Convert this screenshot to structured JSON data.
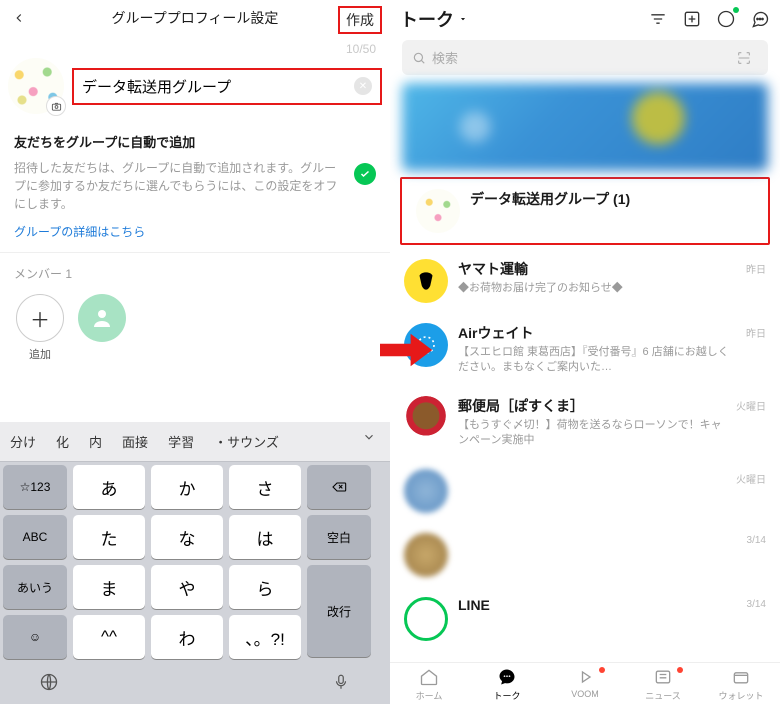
{
  "left": {
    "header": {
      "title": "グループプロフィール設定",
      "create": "作成"
    },
    "counter": "10/50",
    "group_name": "データ転送用グループ",
    "auto_add": {
      "heading": "友だちをグループに自動で追加",
      "desc": "招待した友だちは、グループに自動で追加されます。グループに参加するか友だちに選んでもらうには、この設定をオフにします。",
      "link": "グループの詳細はこちら"
    },
    "members_label": "メンバー 1",
    "members": {
      "add": "追加",
      "user1": "　"
    },
    "keyboard": {
      "pred": [
        "分け",
        "化",
        "内",
        "面接",
        "学習",
        "・サウンズ"
      ],
      "row1": {
        "fn_l": "☆123",
        "k1": "あ",
        "k2": "か",
        "k3": "さ",
        "fn_r": "⌫"
      },
      "row2": {
        "fn_l": "ABC",
        "k1": "た",
        "k2": "な",
        "k3": "は",
        "fn_r": "空白"
      },
      "row3": {
        "fn_l": "あいう",
        "k1": "ま",
        "k2": "や",
        "k3": "ら",
        "fn_r": "改行"
      },
      "row4": {
        "fn_l": "☺",
        "k1": "^^",
        "k2": "わ",
        "k3": "、。?!"
      }
    }
  },
  "right": {
    "header": {
      "title": "トーク"
    },
    "search": "検索",
    "chats": [
      {
        "name": "データ転送用グループ (1)",
        "sub": "",
        "time": ""
      },
      {
        "name": "ヤマト運輸",
        "sub": "◆お荷物お届け完了のお知らせ◆",
        "time": "昨日"
      },
      {
        "name": "Airウェイト",
        "sub": "【スエヒロ館 東葛西店】『受付番号』6 店舗にお越しください。まもなくご案内いた…",
        "time": "昨日"
      },
      {
        "name": "郵便局［ぽすくま］",
        "sub": "【もうすぐ〆切！】荷物を送るならローソンで！キャンペーン実施中",
        "time": "火曜日"
      },
      {
        "name": "　　　　",
        "sub": "　　　　　　　　",
        "time": "火曜日"
      },
      {
        "name": "　　　　",
        "sub": "　　　　　　　　",
        "time": "3/14"
      },
      {
        "name": "LINE",
        "sub": "",
        "time": "3/14"
      }
    ],
    "tabs": {
      "home": "ホーム",
      "talk": "トーク",
      "voom": "VOOM",
      "news": "ニュース",
      "wallet": "ウォレット"
    }
  }
}
